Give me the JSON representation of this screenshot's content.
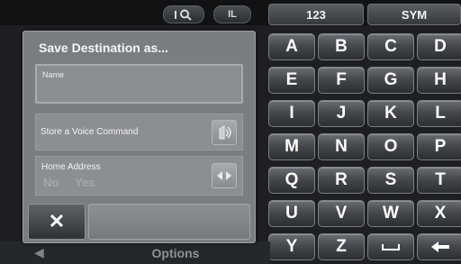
{
  "top": {
    "search_icon": "search-icon",
    "badge_label": "IL",
    "mode_keys": [
      "123",
      "SYM"
    ]
  },
  "keyboard": {
    "rows": [
      [
        "A",
        "B",
        "C",
        "D"
      ],
      [
        "E",
        "F",
        "G",
        "H"
      ],
      [
        "I",
        "J",
        "K",
        "L"
      ],
      [
        "M",
        "N",
        "O",
        "P"
      ],
      [
        "Q",
        "R",
        "S",
        "T"
      ],
      [
        "U",
        "V",
        "W",
        "X"
      ],
      [
        "Y",
        "Z",
        "space",
        "backspace"
      ]
    ]
  },
  "dialog": {
    "title": "Save Destination as...",
    "name_placeholder": "Name",
    "voice_label": "Store a Voice Command",
    "voice_icon": "voice-command-icon",
    "home_label": "Home Address",
    "home_no": "No",
    "home_yes": "Yes",
    "home_icon": "toggle-icon",
    "cancel_glyph": "✕",
    "cancel_icon": "close-icon"
  },
  "bottom": {
    "options_label": "Options",
    "back_icon": "back-arrow-icon"
  }
}
